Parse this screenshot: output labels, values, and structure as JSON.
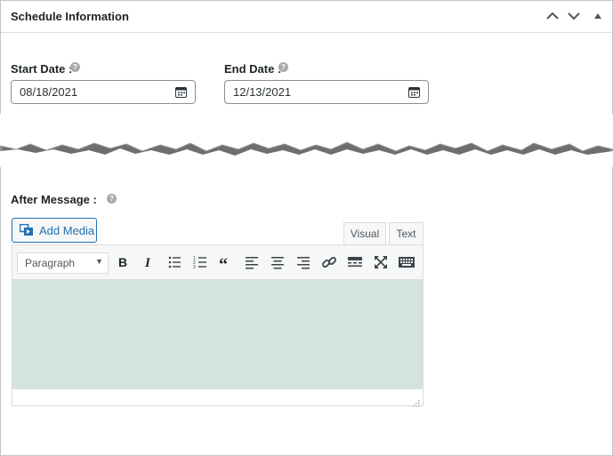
{
  "panel": {
    "title": "Schedule Information",
    "controls": [
      "chevron-up-icon",
      "chevron-down-icon",
      "triangle-up-icon"
    ]
  },
  "start_date": {
    "label": "Start Date :",
    "value": "08/18/2021",
    "help": "?"
  },
  "end_date": {
    "label": "End Date :",
    "value": "12/13/2021",
    "help": "?"
  },
  "after_message": {
    "label": "After Message :",
    "help": "?"
  },
  "editor": {
    "add_media_label": "Add Media",
    "tabs": [
      {
        "label": "Visual",
        "active": true
      },
      {
        "label": "Text",
        "active": false
      }
    ],
    "format_select": "Paragraph",
    "toolbar_buttons": [
      "bold",
      "italic",
      "bullet-list",
      "numbered-list",
      "blockquote",
      "align-left",
      "align-center",
      "align-right",
      "link",
      "read-more",
      "fullscreen",
      "toolbar-toggle"
    ],
    "content_color": "#d3e4de"
  },
  "colors": {
    "accent": "#2271b1",
    "border": "#c3c4c7"
  }
}
